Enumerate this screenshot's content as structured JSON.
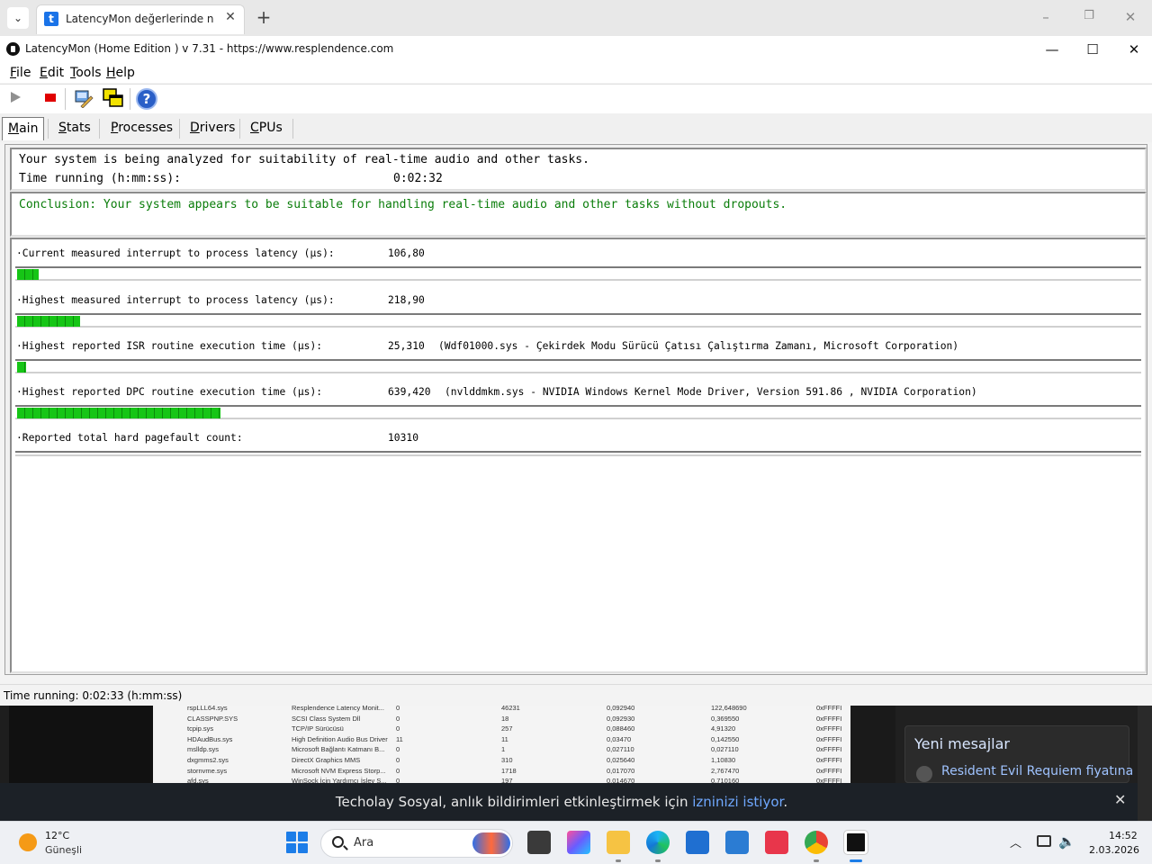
{
  "browser": {
    "tab_title": "LatencyMon değerlerinde neler",
    "tab_favicon_letter": "t",
    "new_tab_symbol": "+",
    "controls": {
      "minimize": "–",
      "restore": "❐",
      "close": "✕"
    }
  },
  "window": {
    "title": "LatencyMon  (Home Edition )  v 7.31 - https://www.resplendence.com",
    "controls": {
      "minimize": "—",
      "maximize": "☐",
      "close": "✕"
    }
  },
  "menu": {
    "file": {
      "accel": "F",
      "rest": "ile"
    },
    "edit": {
      "accel": "E",
      "rest": "dit"
    },
    "tools": {
      "accel": "T",
      "rest": "ools"
    },
    "help": {
      "accel": "H",
      "rest": "elp"
    }
  },
  "toolbar": {
    "icons": [
      "play-icon",
      "stop-icon",
      "tool-icon",
      "windows-icon",
      "help-icon"
    ],
    "help_glyph": "?"
  },
  "tabs": {
    "main": {
      "accel": "M",
      "rest": "ain"
    },
    "stats": {
      "accel": "S",
      "rest": "tats"
    },
    "processes": {
      "accel": "P",
      "rest": "rocesses"
    },
    "drivers": {
      "accel": "D",
      "rest": "rivers"
    },
    "cpus": {
      "accel": "C",
      "rest": "PUs"
    },
    "active": "Main"
  },
  "main": {
    "status_line": "Your system is being analyzed for suitability of real-time audio and other tasks.",
    "time_label": "Time running (h:mm:ss):",
    "time_value": "0:02:32",
    "conclusion": "Conclusion: Your system appears to be suitable for handling real-time audio and other tasks without dropouts.",
    "conclusion_color": "#0a7d0a",
    "metrics": [
      {
        "label": "·Current measured interrupt to process latency (µs):",
        "value": "106,80",
        "detail": "",
        "bar_fraction": 0.0193
      },
      {
        "label": "·Highest measured interrupt to process latency (µs):",
        "value": "218,90",
        "detail": "",
        "bar_fraction": 0.0562
      },
      {
        "label": "·Highest reported ISR routine execution time (µs):",
        "value": "25,310",
        "detail": "(Wdf01000.sys - Çekirdek Modu Sürücü Çatısı Çalıştırma Zamanı, Microsoft Corporation)",
        "bar_fraction": 0.0081
      },
      {
        "label": "·Highest reported DPC routine execution time (µs):",
        "value": "639,420",
        "detail": "(nvlddmkm.sys - NVIDIA Windows Kernel Mode Driver, Version 591.86 , NVIDIA Corporation)",
        "bar_fraction": 0.1809
      },
      {
        "label": "·Reported total hard pagefault count:",
        "value": "10310",
        "detail": "",
        "bar_fraction": 0
      }
    ],
    "bar_color": "#16c516"
  },
  "statusbar": {
    "text": "Time running: 0:02:33  (h:mm:ss)"
  },
  "background_table": {
    "rows": [
      [
        "rspLLL64.sys",
        "Resplendence Latency Monit...",
        "0",
        "46231",
        "0,092940",
        "122,648690",
        "0xFFFFI"
      ],
      [
        "CLASSPNP.SYS",
        "SCSI Class System Dll",
        "0",
        "18",
        "0,092930",
        "0,369550",
        "0xFFFFI"
      ],
      [
        "tcpip.sys",
        "TCP/IP Sürücüsü",
        "0",
        "257",
        "0,088460",
        "4,91320",
        "0xFFFFI"
      ],
      [
        "HDAudBus.sys",
        "High Definition Audio Bus Driver",
        "11",
        "11",
        "0,03470",
        "0,142550",
        "0xFFFFI"
      ],
      [
        "mslldp.sys",
        "Microsoft Bağlantı Katmanı B...",
        "0",
        "1",
        "0,027110",
        "0,027110",
        "0xFFFFI"
      ],
      [
        "dxgmms2.sys",
        "DirectX Graphics MMS",
        "0",
        "310",
        "0,025640",
        "1,10830",
        "0xFFFFI"
      ],
      [
        "stornvme.sys",
        "Microsoft NVM Express Storp...",
        "0",
        "1718",
        "0,017070",
        "2,767470",
        "0xFFFFI"
      ],
      [
        "afd.sys",
        "WinSock İçin Yardımcı İşlev S...",
        "0",
        "197",
        "0,014670",
        "0,710160",
        "0xFFFFI"
      ]
    ]
  },
  "sidebar": {
    "title": "Yeni mesajlar",
    "message": "Resident Evil Requiem fiyatına"
  },
  "notification": {
    "text_before": "Techolay Sosyal, anlık bildirimleri etkinleştirmek için ",
    "link": "izninizi istiyor",
    "text_after": ".",
    "close_symbol": "✕"
  },
  "taskbar": {
    "weather_temp": "12°C",
    "weather_desc": "Güneşli",
    "search_placeholder": "Ara",
    "apps": [
      "file-explorer-dark-icon",
      "microsoft-365-icon",
      "folder-icon",
      "edge-icon",
      "store-icon",
      "outlook-icon",
      "pocket-icon",
      "chrome-icon",
      "latencymon-icon"
    ],
    "time": "14:52",
    "date": "2.03.2026"
  }
}
